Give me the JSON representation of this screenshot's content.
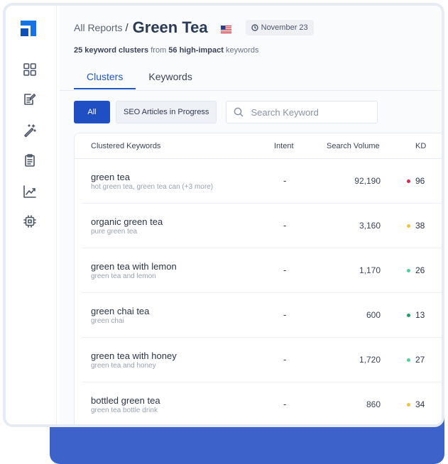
{
  "header": {
    "breadcrumb": "All Reports",
    "separator": "/",
    "title": "Green Tea",
    "date": "November 23"
  },
  "subline": {
    "clusters_count": "25 keyword clusters",
    "from_text": "from",
    "keywords_count": "56 high-impact",
    "keywords_word": "keywords"
  },
  "tabs": [
    {
      "label": "Clusters",
      "active": true
    },
    {
      "label": "Keywords",
      "active": false
    }
  ],
  "filters": {
    "all_label": "All",
    "seo_label": "SEO Articles in Progress",
    "search_placeholder": "Search Keyword"
  },
  "table": {
    "columns": [
      "Clustered Keywords",
      "Intent",
      "Search Volume",
      "KD"
    ],
    "rows": [
      {
        "keyword": "green tea",
        "related": "hot green tea, green tea can (+3 more)",
        "intent": "-",
        "volume": "92,190",
        "kd": "96",
        "kd_color": "#d6264b"
      },
      {
        "keyword": "organic green tea",
        "related": "pure green tea",
        "intent": "-",
        "volume": "3,160",
        "kd": "38",
        "kd_color": "#f3c13a"
      },
      {
        "keyword": "green tea with lemon",
        "related": "green tea and lemon",
        "intent": "-",
        "volume": "1,170",
        "kd": "26",
        "kd_color": "#4fcf9a"
      },
      {
        "keyword": "green chai tea",
        "related": "green chai",
        "intent": "-",
        "volume": "600",
        "kd": "13",
        "kd_color": "#1f9e6a"
      },
      {
        "keyword": "green tea with honey",
        "related": "green tea and honey",
        "intent": "-",
        "volume": "1,720",
        "kd": "27",
        "kd_color": "#4fcf9a"
      },
      {
        "keyword": "bottled green tea",
        "related": "green tea bottle drink",
        "intent": "-",
        "volume": "860",
        "kd": "34",
        "kd_color": "#f3c13a"
      }
    ]
  },
  "colors": {
    "accent": "#1f4fc2",
    "brand": "#1473e6",
    "band": "#3d63cb"
  },
  "icons": {
    "sidebar": [
      "dashboard-icon",
      "edit-document-icon",
      "magic-wand-icon",
      "clipboard-icon",
      "chart-line-icon",
      "chip-icon"
    ]
  }
}
